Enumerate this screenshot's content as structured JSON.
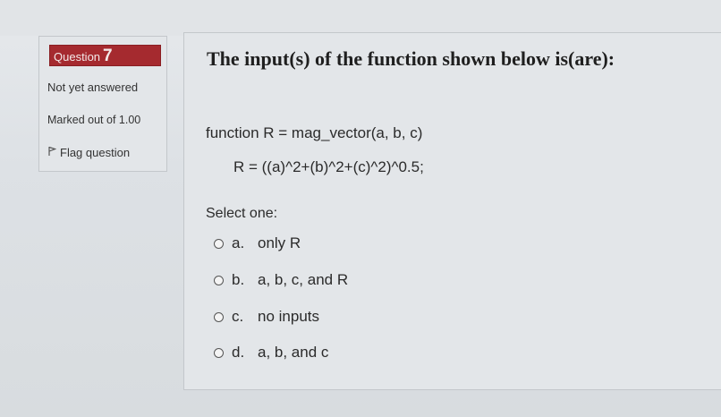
{
  "info": {
    "question_label": "Question",
    "question_number": "7",
    "state": "Not yet answered",
    "grade": "Marked out of 1.00",
    "flag_label": "Flag question"
  },
  "question": {
    "text": "The input(s) of the function shown below is(are):",
    "code_line_1": "function R = mag_vector(a, b, c)",
    "code_line_2": "R = ((a)^2+(b)^2+(c)^2)^0.5;",
    "prompt": "Select one:"
  },
  "answers": [
    {
      "letter": "a.",
      "text": "only R"
    },
    {
      "letter": "b.",
      "text": "a, b, c, and R"
    },
    {
      "letter": "c.",
      "text": "no inputs"
    },
    {
      "letter": "d.",
      "text": "a, b, and c"
    }
  ],
  "colors": {
    "question_badge": "#a52a2f",
    "panel_background": "#e3e6e9"
  },
  "icons": {
    "flag": "flag-icon",
    "radio": "radio-unchecked-icon"
  }
}
